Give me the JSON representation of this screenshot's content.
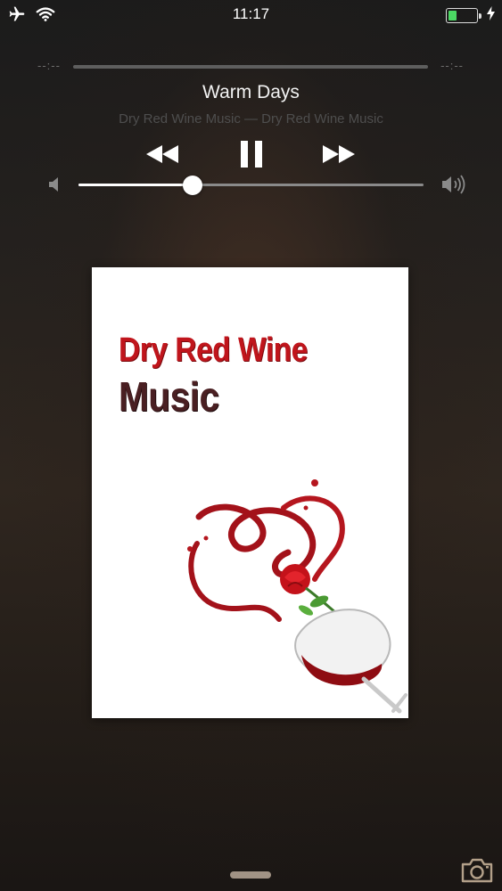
{
  "status_bar": {
    "time": "11:17",
    "icons": [
      "airplane-icon",
      "wifi-icon",
      "battery-icon",
      "charging-bolt-icon"
    ],
    "battery_level": 0.3,
    "battery_color": "#4cd964"
  },
  "player": {
    "elapsed": "--:--",
    "remaining": "--:--",
    "title": "Warm Days",
    "subtitle": "Dry Red Wine Music — Dry Red Wine Music",
    "controls": [
      "rewind-icon",
      "pause-icon",
      "fast-forward-icon"
    ],
    "volume_level": 0.33
  },
  "artwork": {
    "line1": "Dry Red Wine",
    "line2": "Music",
    "accent_color": "#c0151c"
  },
  "bottom": {
    "icons": [
      "home-grabber",
      "camera-icon"
    ]
  }
}
